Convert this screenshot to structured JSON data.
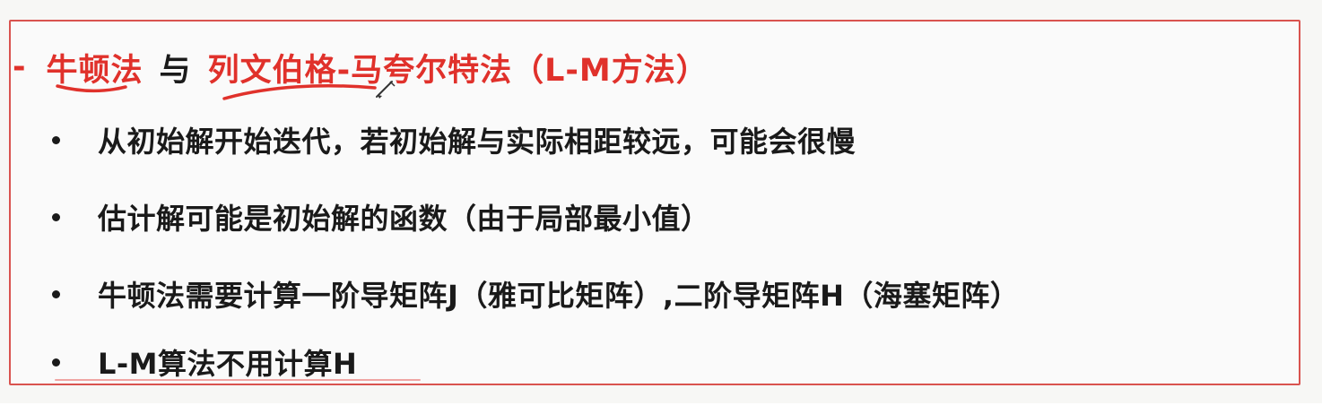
{
  "heading": {
    "dash": "-",
    "term_a": "牛顿法",
    "conjunction": "与",
    "term_b": "列文伯格-马夸尔特法（L-M方法）"
  },
  "bullets": [
    "从初始解开始迭代，若初始解与实际相距较远，可能会很慢",
    "估计解可能是初始解的函数（由于局部最小值）",
    "牛顿法需要计算一阶导矩阵J（雅可比矩阵）,二阶导矩阵H（海塞矩阵）",
    "L-M算法不用计算H"
  ],
  "colors": {
    "accent": "#e0312b",
    "frame": "#d9534f",
    "text": "#1a1a1a"
  }
}
